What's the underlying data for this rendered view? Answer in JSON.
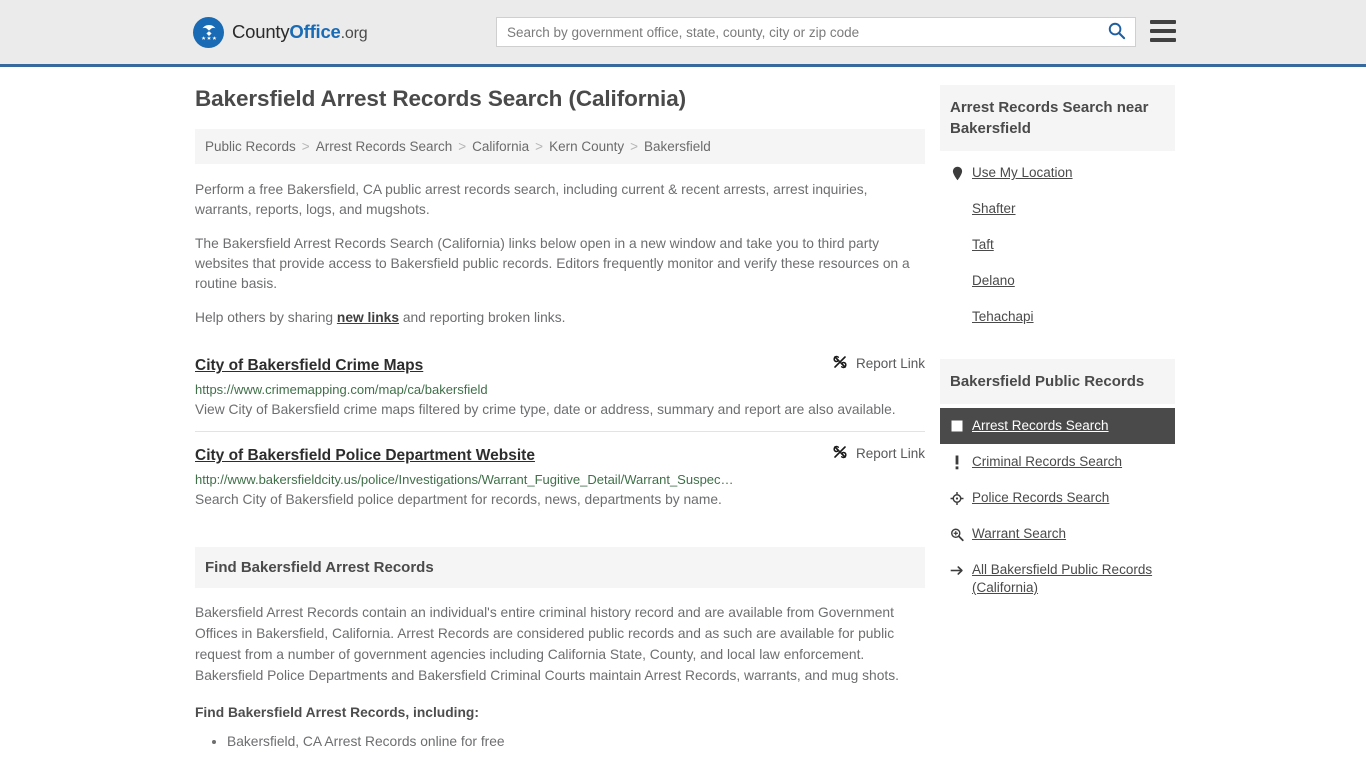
{
  "header": {
    "logo": {
      "icon": "eagle-seal-icon",
      "text_county": "County",
      "text_office": "Office",
      "text_org": ".org"
    },
    "search": {
      "placeholder": "Search by government office, state, county, city or zip code",
      "value": "",
      "search_icon": "search-icon"
    },
    "menu_icon": "hamburger-menu-icon",
    "accent_color": "#36699d",
    "background_color": "#ebebeb"
  },
  "main": {
    "title": "Bakersfield Arrest Records Search (California)",
    "breadcrumb": [
      "Public Records",
      "Arrest Records Search",
      "California",
      "Kern County",
      "Bakersfield"
    ],
    "breadcrumb_separator": ">",
    "intro": {
      "p1": "Perform a free Bakersfield, CA public arrest records search, including current & recent arrests, arrest inquiries, warrants, reports, logs, and mugshots.",
      "p2": "The Bakersfield Arrest Records Search (California) links below open in a new window and take you to third party websites that provide access to Bakersfield public records. Editors frequently monitor and verify these resources on a routine basis.",
      "p3_before": "Help others by sharing ",
      "p3_link": "new links",
      "p3_after": " and reporting broken links."
    },
    "results": [
      {
        "title": "City of Bakersfield Crime Maps",
        "url": "https://www.crimemapping.com/map/ca/bakersfield",
        "description": "View City of Bakersfield crime maps filtered by crime type, date or address, summary and report are also available.",
        "report_label": "Report Link",
        "report_icon": "broken-link-icon"
      },
      {
        "title": "City of Bakersfield Police Department Website",
        "url": "http://www.bakersfieldcity.us/police/Investigations/Warrant_Fugitive_Detail/Warrant_Suspec…",
        "description": "Search City of Bakersfield police department for records, news, departments by name.",
        "report_label": "Report Link",
        "report_icon": "broken-link-icon"
      }
    ],
    "section": {
      "heading": "Find Bakersfield Arrest Records",
      "body": "Bakersfield Arrest Records contain an individual's entire criminal history record and are available from Government Offices in Bakersfield, California. Arrest Records are considered public records and as such are available for public request from a number of government agencies including California State, County, and local law enforcement. Bakersfield Police Departments and Bakersfield Criminal Courts maintain Arrest Records, warrants, and mug shots.",
      "subheading": "Find Bakersfield Arrest Records, including:",
      "list": [
        "Bakersfield, CA Arrest Records online for free"
      ]
    }
  },
  "sidebar": {
    "near": {
      "heading": "Arrest Records Search near Bakersfield",
      "items": [
        {
          "label": "Use My Location",
          "icon": "map-pin-icon"
        },
        {
          "label": "Shafter",
          "icon": ""
        },
        {
          "label": "Taft",
          "icon": ""
        },
        {
          "label": "Delano",
          "icon": ""
        },
        {
          "label": "Tehachapi",
          "icon": ""
        }
      ]
    },
    "public_records": {
      "heading": "Bakersfield Public Records",
      "items": [
        {
          "label": "Arrest Records Search",
          "icon": "square-icon",
          "active": true
        },
        {
          "label": "Criminal Records Search",
          "icon": "exclamation-icon",
          "active": false
        },
        {
          "label": "Police Records Search",
          "icon": "crosshair-icon",
          "active": false
        },
        {
          "label": "Warrant Search",
          "icon": "magnifier-plus-icon",
          "active": false
        },
        {
          "label": "All Bakersfield Public Records (California)",
          "icon": "arrow-right-icon",
          "active": false
        }
      ],
      "active_background": "#4a4a4a"
    }
  }
}
